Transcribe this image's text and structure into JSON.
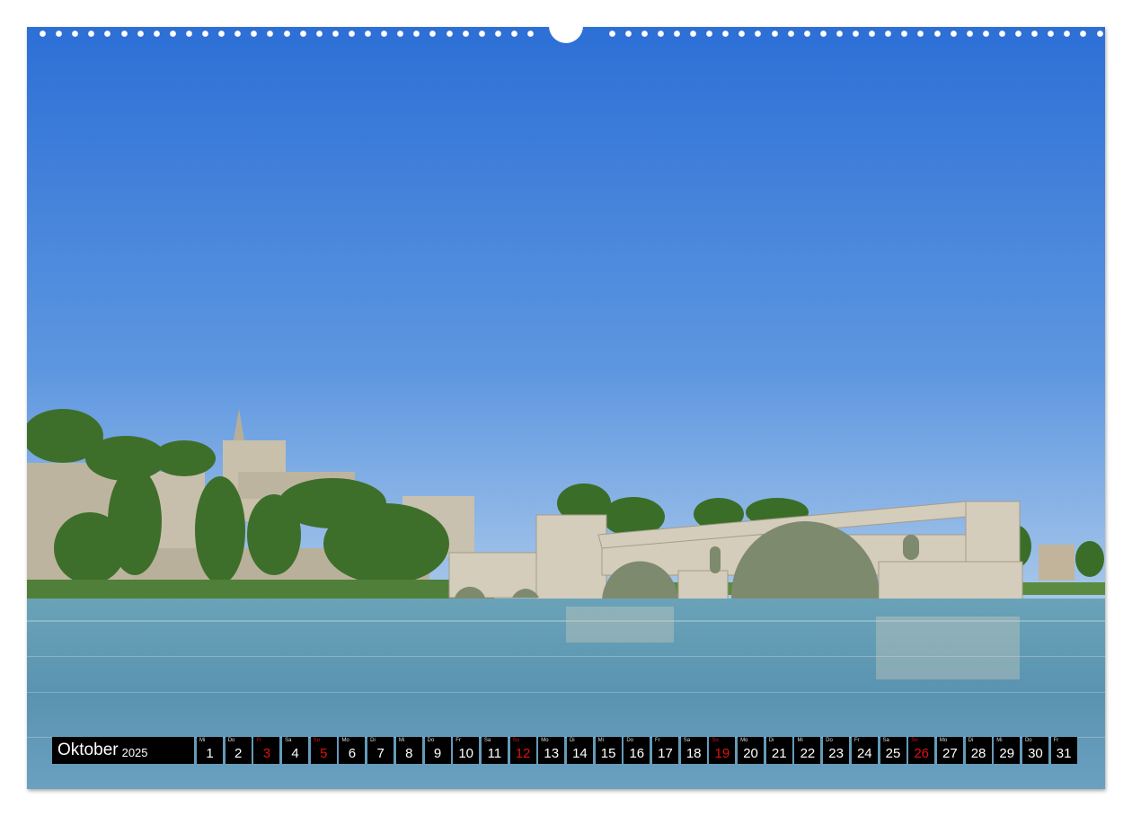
{
  "calendar": {
    "month": "Oktober",
    "year": "2025",
    "days": [
      {
        "wd": "Mi",
        "d": "1",
        "red": false
      },
      {
        "wd": "Do",
        "d": "2",
        "red": false
      },
      {
        "wd": "Fr",
        "d": "3",
        "red": true
      },
      {
        "wd": "Sa",
        "d": "4",
        "red": false
      },
      {
        "wd": "So",
        "d": "5",
        "red": true
      },
      {
        "wd": "Mo",
        "d": "6",
        "red": false
      },
      {
        "wd": "Di",
        "d": "7",
        "red": false
      },
      {
        "wd": "Mi",
        "d": "8",
        "red": false
      },
      {
        "wd": "Do",
        "d": "9",
        "red": false
      },
      {
        "wd": "Fr",
        "d": "10",
        "red": false
      },
      {
        "wd": "Sa",
        "d": "11",
        "red": false
      },
      {
        "wd": "So",
        "d": "12",
        "red": true
      },
      {
        "wd": "Mo",
        "d": "13",
        "red": false
      },
      {
        "wd": "Di",
        "d": "14",
        "red": false
      },
      {
        "wd": "Mi",
        "d": "15",
        "red": false
      },
      {
        "wd": "Do",
        "d": "16",
        "red": false
      },
      {
        "wd": "Fr",
        "d": "17",
        "red": false
      },
      {
        "wd": "Sa",
        "d": "18",
        "red": false
      },
      {
        "wd": "So",
        "d": "19",
        "red": true
      },
      {
        "wd": "Mo",
        "d": "20",
        "red": false
      },
      {
        "wd": "Di",
        "d": "21",
        "red": false
      },
      {
        "wd": "Mi",
        "d": "22",
        "red": false
      },
      {
        "wd": "Do",
        "d": "23",
        "red": false
      },
      {
        "wd": "Fr",
        "d": "24",
        "red": false
      },
      {
        "wd": "Sa",
        "d": "25",
        "red": false
      },
      {
        "wd": "So",
        "d": "26",
        "red": true
      },
      {
        "wd": "Mo",
        "d": "27",
        "red": false
      },
      {
        "wd": "Di",
        "d": "28",
        "red": false
      },
      {
        "wd": "Mi",
        "d": "29",
        "red": false
      },
      {
        "wd": "Do",
        "d": "30",
        "red": false
      },
      {
        "wd": "Fr",
        "d": "31",
        "red": false
      }
    ]
  },
  "colors": {
    "sky_top": "#2f72d8",
    "sky_bottom": "#8fb8e6",
    "water": "#5f9bb8",
    "stone": "#cfc7b6",
    "trees": "#3f7a2c",
    "sunday_red": "#e01010"
  },
  "photo": {
    "subject_icons": [
      "bridge-photo",
      "palace-photo"
    ]
  }
}
